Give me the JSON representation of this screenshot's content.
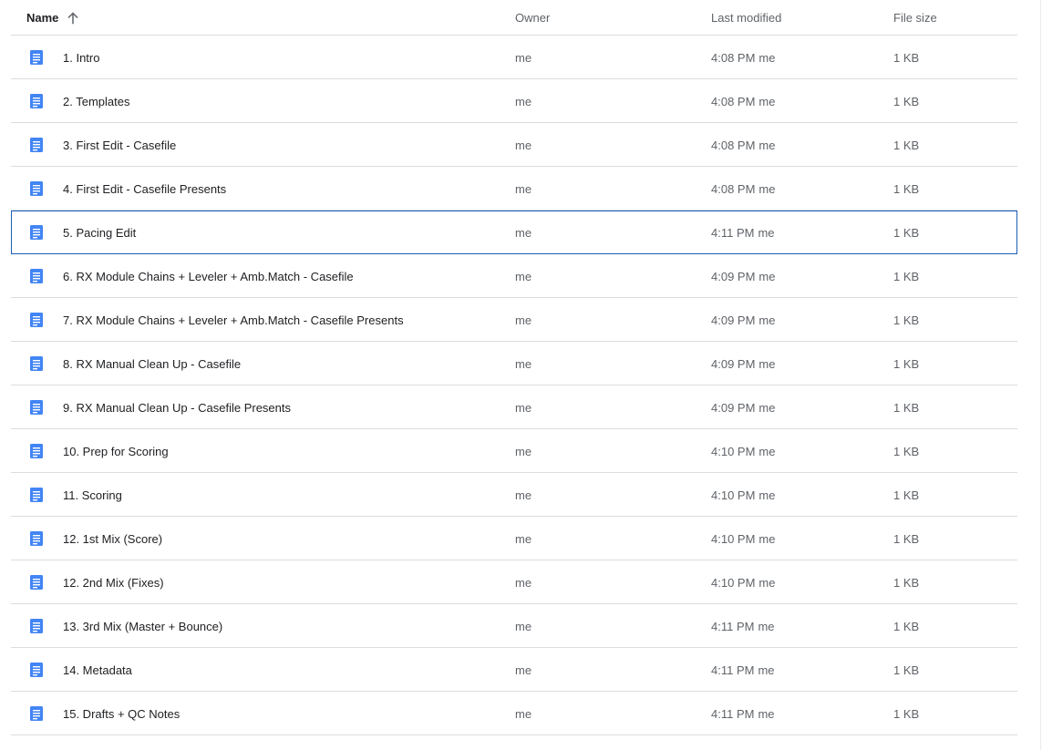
{
  "columns": {
    "name": "Name",
    "owner": "Owner",
    "last_modified": "Last modified",
    "file_size": "File size"
  },
  "sort": {
    "column": "name",
    "direction": "ascending",
    "icon": "arrow-up-icon"
  },
  "colors": {
    "doc_icon": "#4285f4",
    "selection_border": "#1a5fb4",
    "divider": "#dadce0",
    "secondary_text": "#5f6368"
  },
  "files": [
    {
      "name": "1. Intro",
      "owner": "me",
      "modified_time": "4:08 PM",
      "modified_by": "me",
      "size": "1 KB",
      "icon": "google-doc-icon"
    },
    {
      "name": "2. Templates",
      "owner": "me",
      "modified_time": "4:08 PM",
      "modified_by": "me",
      "size": "1 KB",
      "icon": "google-doc-icon"
    },
    {
      "name": "3. First Edit - Casefile",
      "owner": "me",
      "modified_time": "4:08 PM",
      "modified_by": "me",
      "size": "1 KB",
      "icon": "google-doc-icon"
    },
    {
      "name": "4. First Edit - Casefile Presents",
      "owner": "me",
      "modified_time": "4:08 PM",
      "modified_by": "me",
      "size": "1 KB",
      "icon": "google-doc-icon"
    },
    {
      "name": "5. Pacing Edit",
      "owner": "me",
      "modified_time": "4:11 PM",
      "modified_by": "me",
      "size": "1 KB",
      "icon": "google-doc-icon",
      "selected": true
    },
    {
      "name": "6. RX Module Chains + Leveler + Amb.Match - Casefile",
      "owner": "me",
      "modified_time": "4:09 PM",
      "modified_by": "me",
      "size": "1 KB",
      "icon": "google-doc-icon"
    },
    {
      "name": "7. RX Module Chains + Leveler + Amb.Match - Casefile Presents",
      "owner": "me",
      "modified_time": "4:09 PM",
      "modified_by": "me",
      "size": "1 KB",
      "icon": "google-doc-icon"
    },
    {
      "name": "8. RX Manual Clean Up - Casefile",
      "owner": "me",
      "modified_time": "4:09 PM",
      "modified_by": "me",
      "size": "1 KB",
      "icon": "google-doc-icon"
    },
    {
      "name": "9. RX Manual Clean Up - Casefile Presents",
      "owner": "me",
      "modified_time": "4:09 PM",
      "modified_by": "me",
      "size": "1 KB",
      "icon": "google-doc-icon"
    },
    {
      "name": "10. Prep for Scoring",
      "owner": "me",
      "modified_time": "4:10 PM",
      "modified_by": "me",
      "size": "1 KB",
      "icon": "google-doc-icon"
    },
    {
      "name": "11. Scoring",
      "owner": "me",
      "modified_time": "4:10 PM",
      "modified_by": "me",
      "size": "1 KB",
      "icon": "google-doc-icon"
    },
    {
      "name": "12. 1st Mix (Score)",
      "owner": "me",
      "modified_time": "4:10 PM",
      "modified_by": "me",
      "size": "1 KB",
      "icon": "google-doc-icon"
    },
    {
      "name": "12. 2nd Mix (Fixes)",
      "owner": "me",
      "modified_time": "4:10 PM",
      "modified_by": "me",
      "size": "1 KB",
      "icon": "google-doc-icon"
    },
    {
      "name": "13. 3rd Mix (Master + Bounce)",
      "owner": "me",
      "modified_time": "4:11 PM",
      "modified_by": "me",
      "size": "1 KB",
      "icon": "google-doc-icon"
    },
    {
      "name": "14. Metadata",
      "owner": "me",
      "modified_time": "4:11 PM",
      "modified_by": "me",
      "size": "1 KB",
      "icon": "google-doc-icon"
    },
    {
      "name": "15. Drafts + QC Notes",
      "owner": "me",
      "modified_time": "4:11 PM",
      "modified_by": "me",
      "size": "1 KB",
      "icon": "google-doc-icon"
    }
  ]
}
